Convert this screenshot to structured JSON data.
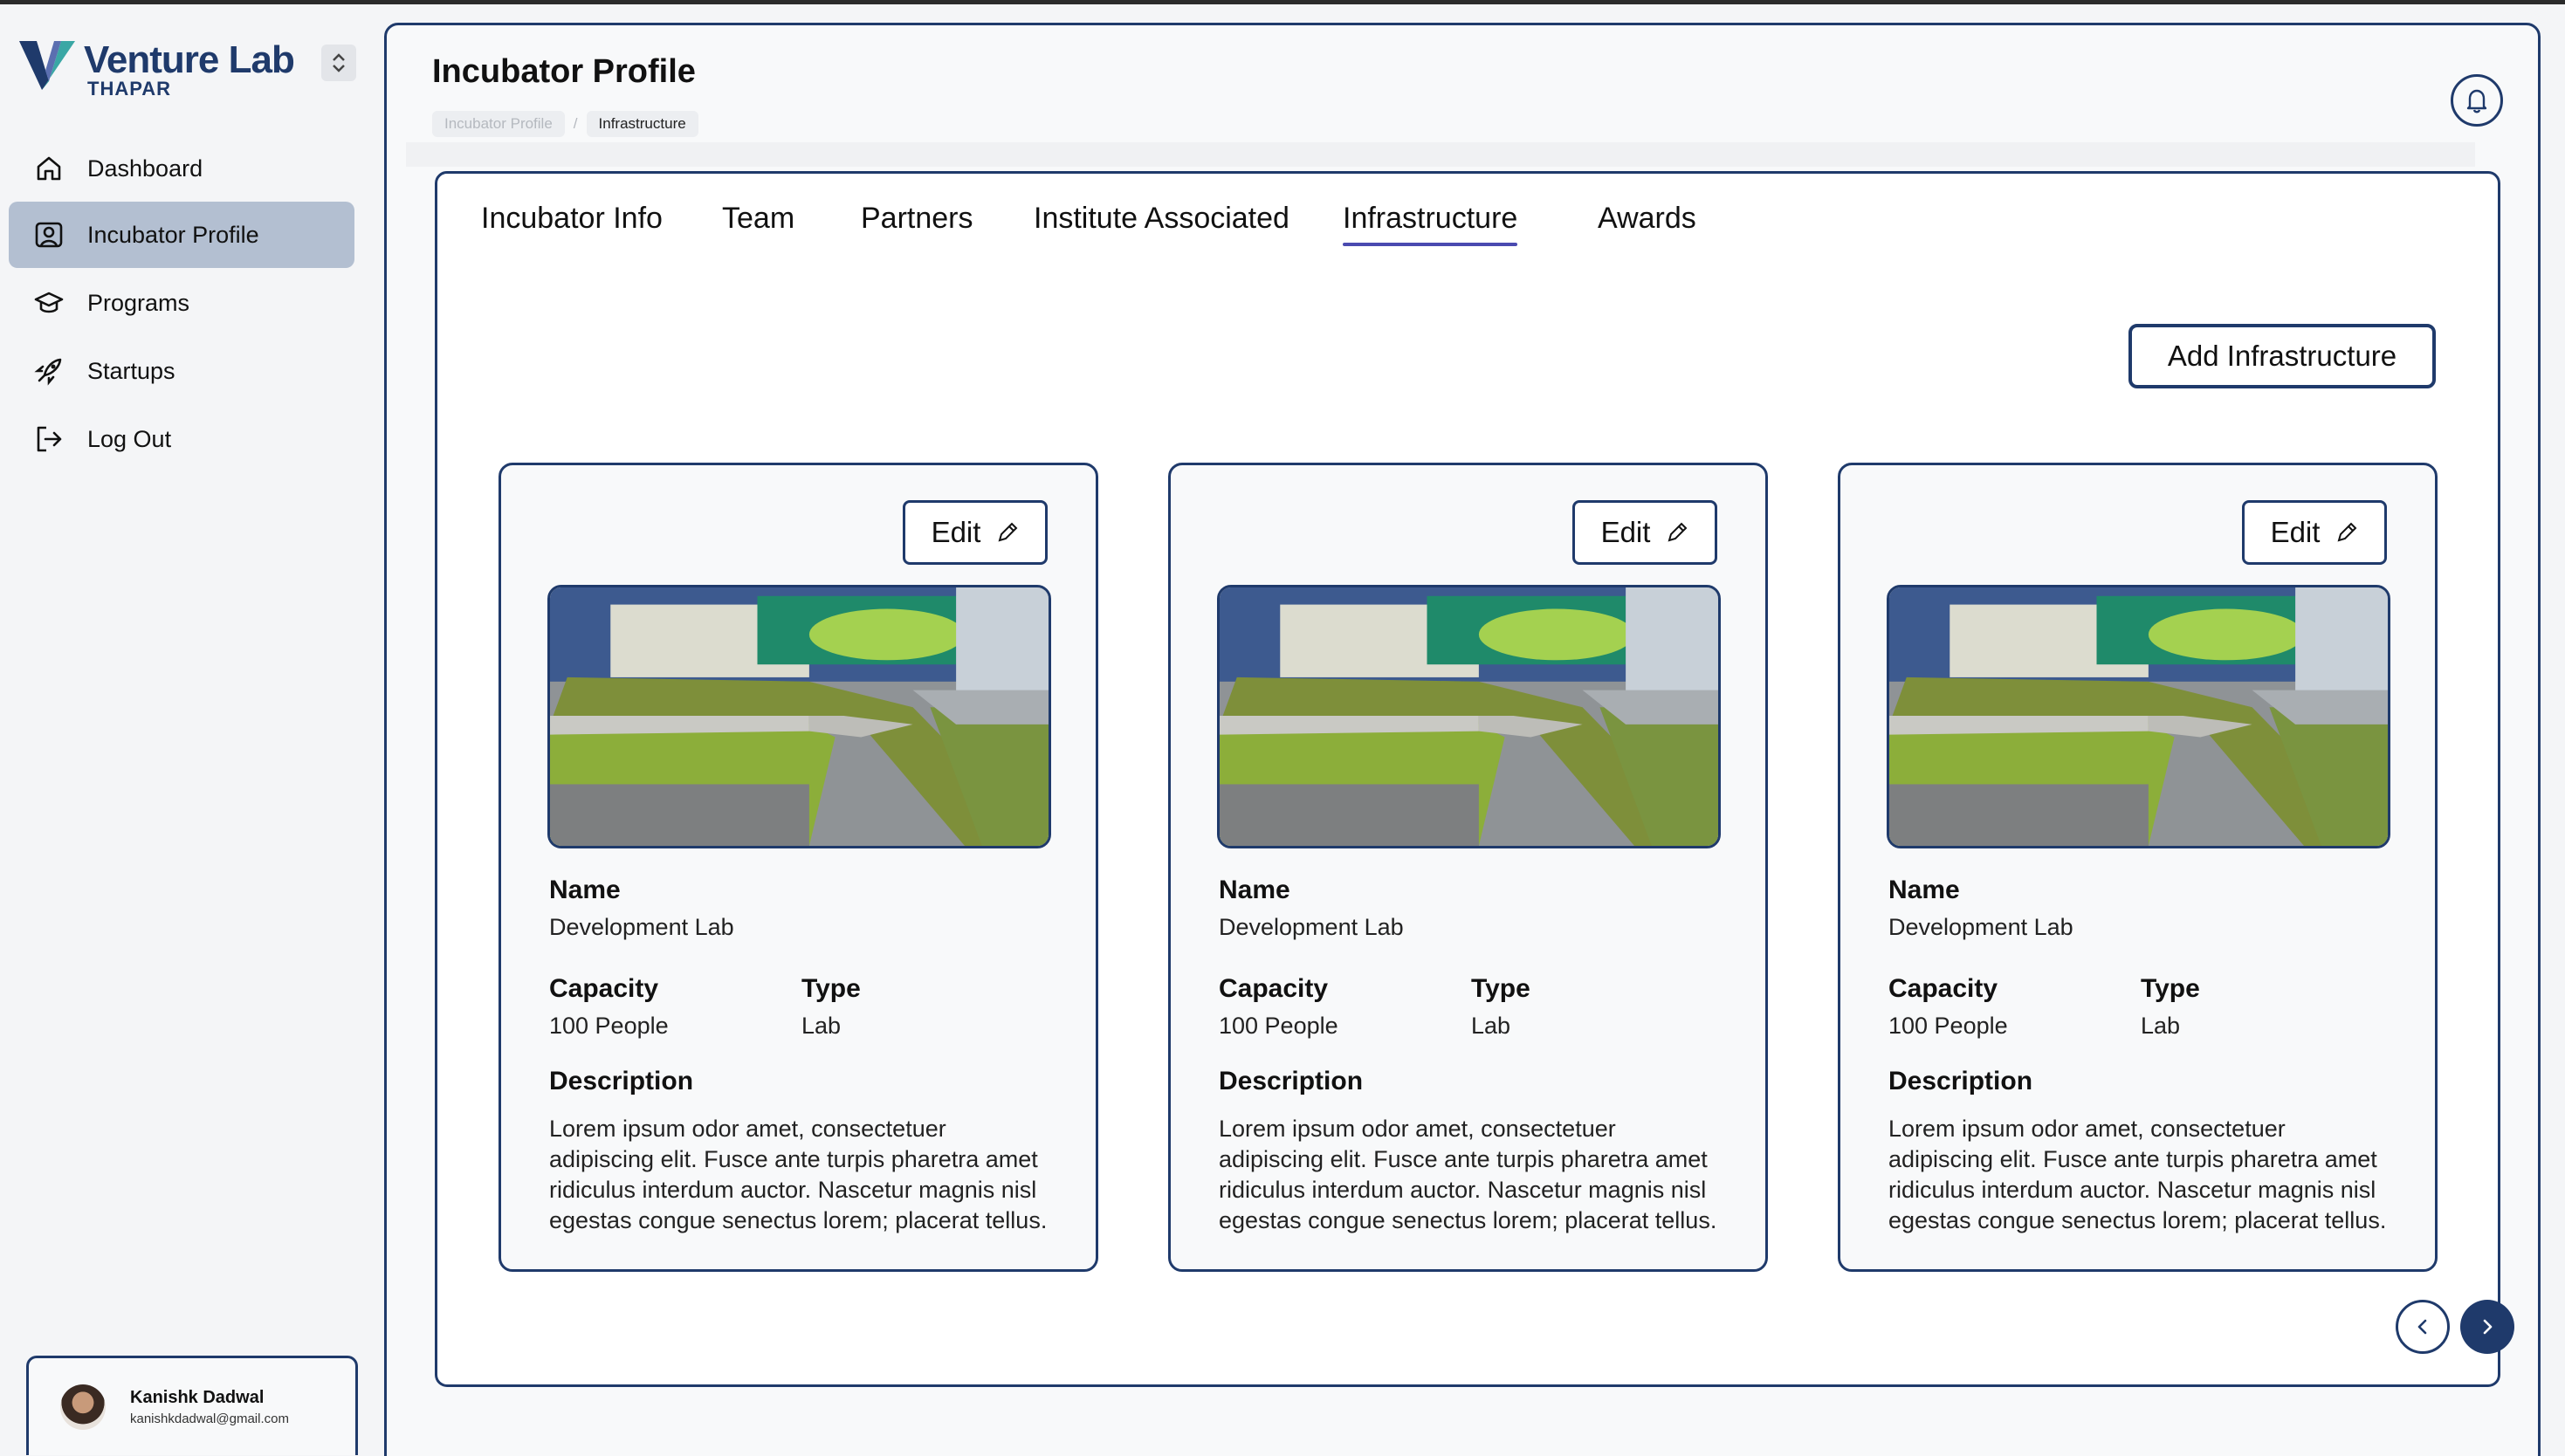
{
  "app": {
    "logo_title": "Venture Lab",
    "logo_sub": "THAPAR"
  },
  "sidebar": {
    "items": [
      {
        "label": "Dashboard",
        "icon": "home-icon"
      },
      {
        "label": "Incubator Profile",
        "icon": "profile-icon",
        "active": true
      },
      {
        "label": "Programs",
        "icon": "graduation-cap-icon"
      },
      {
        "label": "Startups",
        "icon": "rocket-icon"
      },
      {
        "label": "Log Out",
        "icon": "logout-icon"
      }
    ],
    "user": {
      "name": "Kanishk Dadwal",
      "email": "kanishkdadwal@gmail.com"
    }
  },
  "header": {
    "title": "Incubator Profile",
    "breadcrumb": [
      "Incubator Profile",
      "Infrastructure"
    ],
    "breadcrumb_separator": "/"
  },
  "tabs": [
    {
      "label": "Incubator Info"
    },
    {
      "label": "Team"
    },
    {
      "label": "Partners"
    },
    {
      "label": "Institute Associated"
    },
    {
      "label": "Infrastructure",
      "active": true
    },
    {
      "label": "Awards"
    }
  ],
  "content": {
    "add_button": "Add Infrastructure",
    "edit_label": "Edit",
    "field_labels": {
      "name": "Name",
      "capacity": "Capacity",
      "type": "Type",
      "description": "Description"
    },
    "cards": [
      {
        "name": "Development Lab",
        "capacity": "100 People",
        "type": "Lab",
        "description": "Lorem ipsum odor amet, consectetuer adipiscing elit. Fusce ante turpis pharetra amet ridiculus interdum auctor. Nascetur magnis nisl egestas congue senectus lorem; placerat tellus."
      },
      {
        "name": "Development Lab",
        "capacity": "100 People",
        "type": "Lab",
        "description": "Lorem ipsum odor amet, consectetuer adipiscing elit. Fusce ante turpis pharetra amet ridiculus interdum auctor. Nascetur magnis nisl egestas congue senectus lorem; placerat tellus."
      },
      {
        "name": "Development Lab",
        "capacity": "100 People",
        "type": "Lab",
        "description": "Lorem ipsum odor amet, consectetuer adipiscing elit. Fusce ante turpis pharetra amet ridiculus interdum auctor. Nascetur magnis nisl egestas congue senectus lorem; placerat tellus."
      }
    ]
  },
  "colors": {
    "brand": "#1f3a6b",
    "active_nav": "#b3bfd1",
    "tab_underline": "#4a4ab0"
  }
}
